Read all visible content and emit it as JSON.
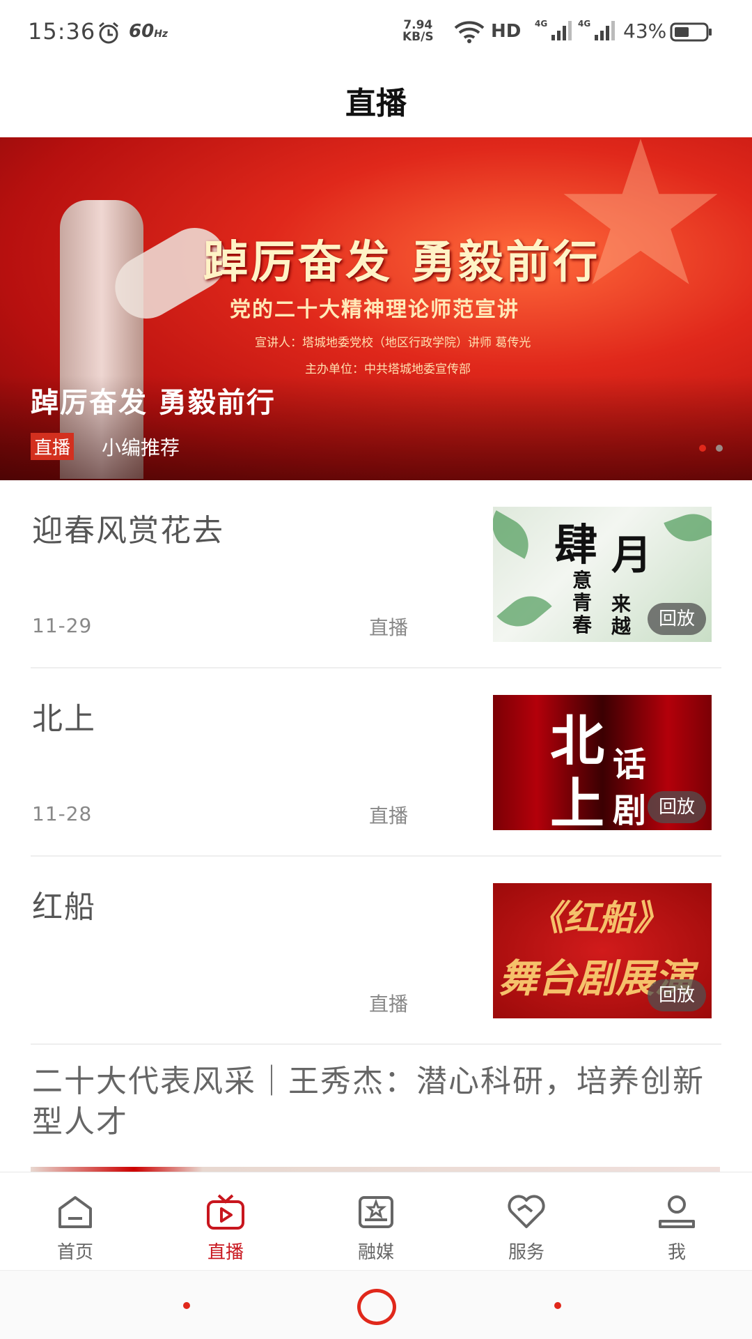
{
  "status_bar": {
    "time": "15:36",
    "refresh": "60",
    "refresh_unit": "Hz",
    "net_speed": "7.94",
    "net_unit": "KB/S",
    "hd": "HD",
    "signal_1": "4G",
    "signal_2": "4G",
    "battery": "43%"
  },
  "header": {
    "title": "直播"
  },
  "banner": {
    "image_headline": "踔厉奋发 勇毅前行",
    "image_subheadline": "党的二十大精神理论师范宣讲",
    "image_speaker": "宣讲人：塔城地委党校（地区行政学院）讲师 葛传光",
    "image_organizer": "主办单位：中共塔城地委宣传部",
    "caption": "踔厉奋发  勇毅前行",
    "tag": "直播",
    "subtag": "小编推荐"
  },
  "items": [
    {
      "title": "迎春风赏花去",
      "date": "11-29",
      "type": "直播",
      "replay": "回放",
      "thumb_text": [
        "肆",
        "月",
        "意青春",
        "来越"
      ]
    },
    {
      "title": "北上",
      "date": "11-28",
      "type": "直播",
      "replay": "回放",
      "thumb_text": [
        "北",
        "上",
        "话",
        "剧"
      ]
    },
    {
      "title": "红船",
      "date": "",
      "type": "直播",
      "replay": "回放",
      "thumb_text": [
        "《红船》",
        "舞台剧展演"
      ]
    }
  ],
  "long_item": {
    "title": "二十大代表风采｜王秀杰：潜心科研，培养创新型人才"
  },
  "tabbar": {
    "tabs": [
      {
        "label": "首页",
        "icon": "home-icon",
        "active": false
      },
      {
        "label": "直播",
        "icon": "live-tv-icon",
        "active": true
      },
      {
        "label": "融媒",
        "icon": "media-icon",
        "active": false
      },
      {
        "label": "服务",
        "icon": "heart-service-icon",
        "active": false
      },
      {
        "label": "我",
        "icon": "user-icon",
        "active": false
      }
    ]
  },
  "colors": {
    "accent": "#c8161e",
    "banner_red": "#e0281b",
    "text_grey": "#666666"
  }
}
